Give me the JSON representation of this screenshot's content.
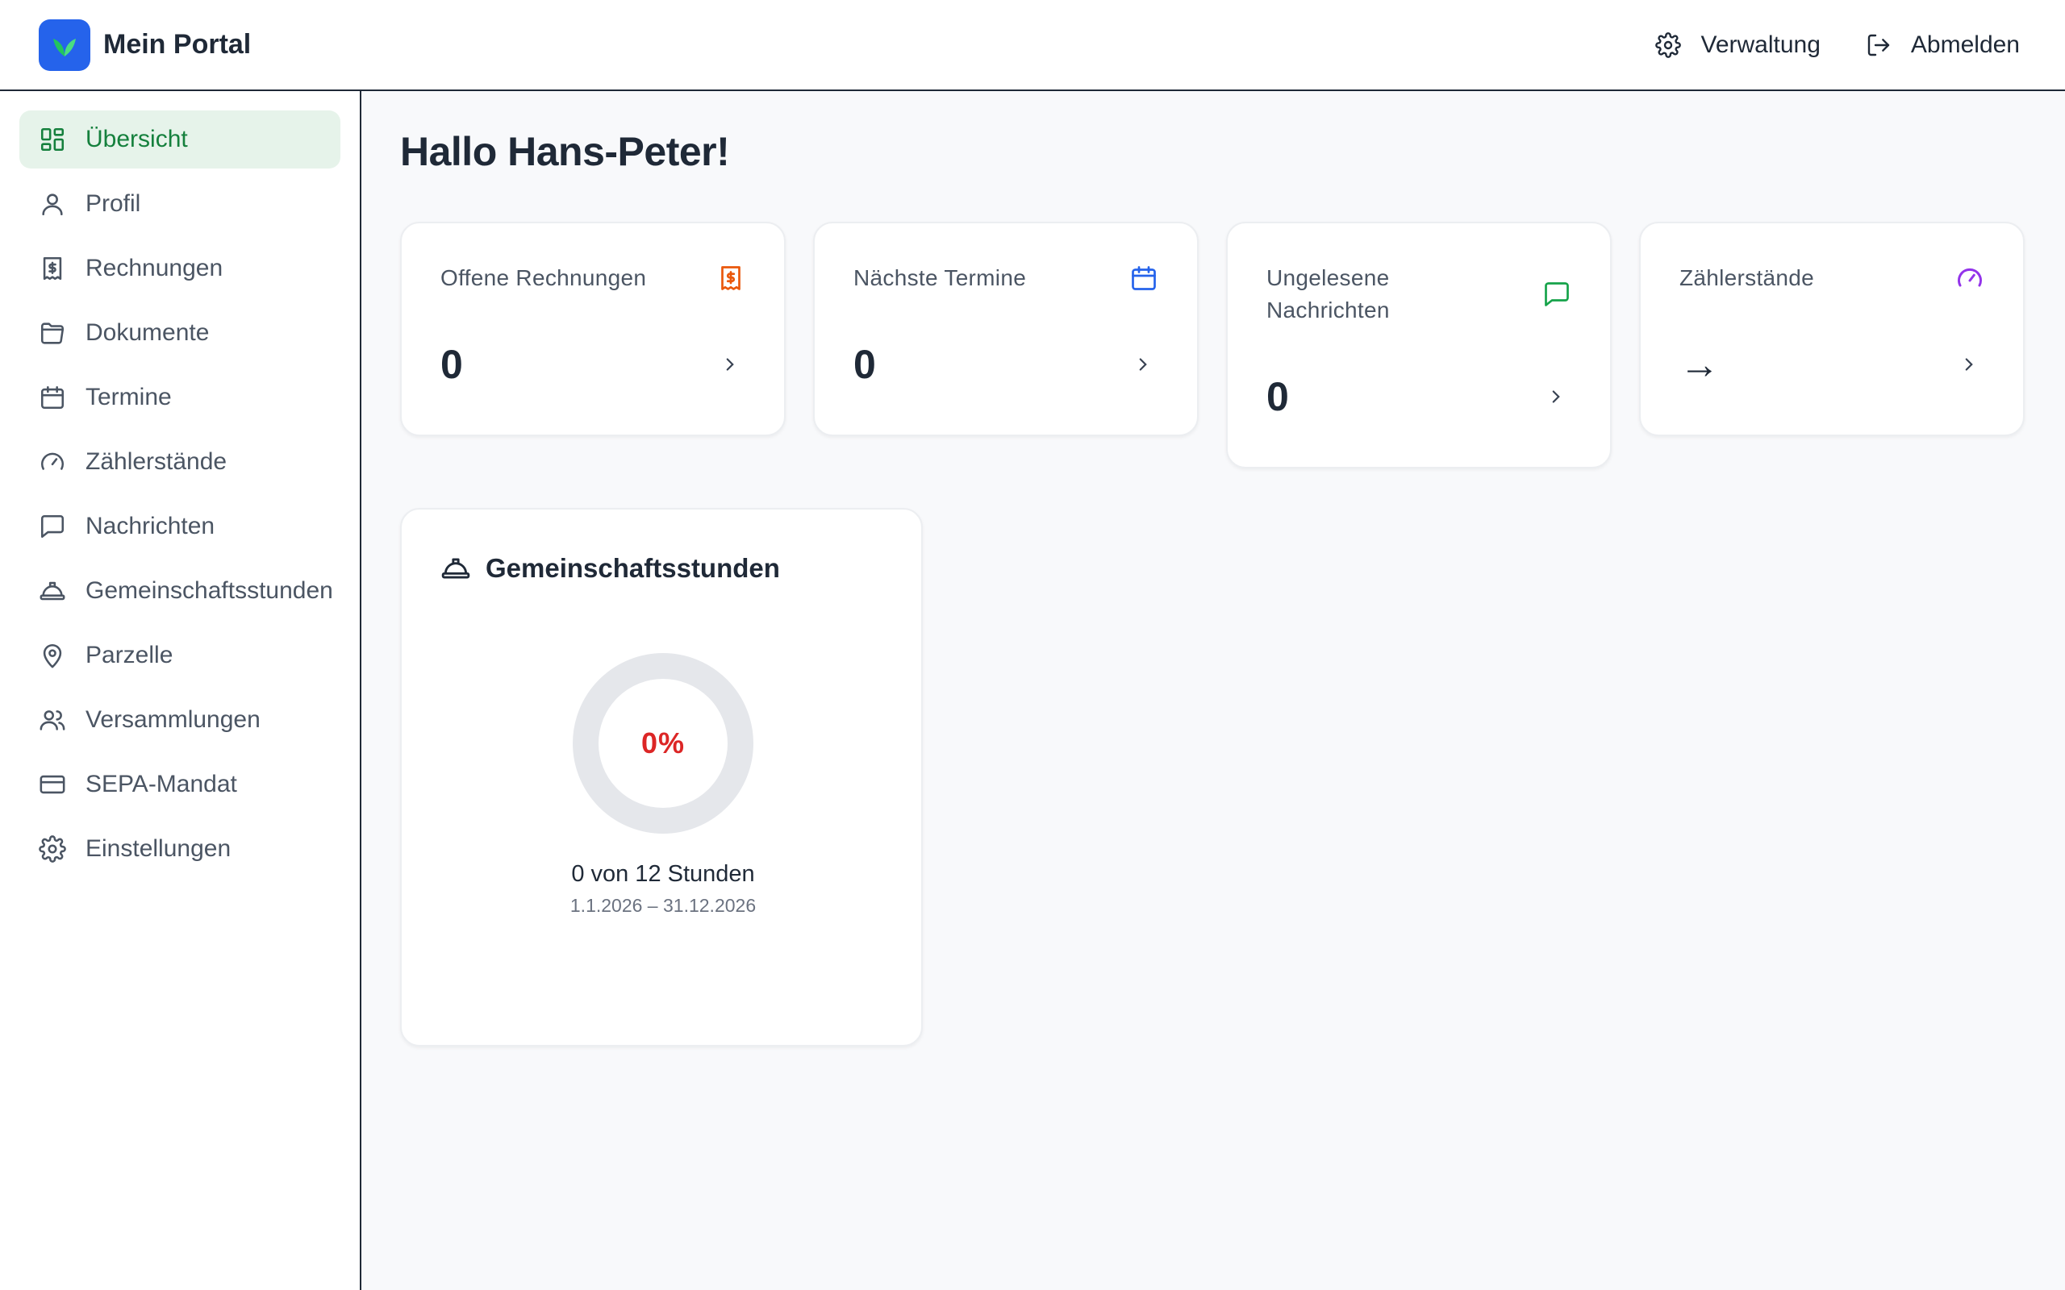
{
  "app": {
    "title": "Mein Portal"
  },
  "header": {
    "admin_label": "Verwaltung",
    "logout_label": "Abmelden"
  },
  "sidebar": {
    "items": [
      {
        "label": "Übersicht",
        "icon": "dashboard-icon",
        "active": true
      },
      {
        "label": "Profil",
        "icon": "user-icon"
      },
      {
        "label": "Rechnungen",
        "icon": "invoice-icon"
      },
      {
        "label": "Dokumente",
        "icon": "folder-icon"
      },
      {
        "label": "Termine",
        "icon": "calendar-icon"
      },
      {
        "label": "Zählerstände",
        "icon": "gauge-icon"
      },
      {
        "label": "Nachrichten",
        "icon": "message-icon"
      },
      {
        "label": "Gemeinschaftsstunden",
        "icon": "hardhat-icon"
      },
      {
        "label": "Parzelle",
        "icon": "map-pin-icon"
      },
      {
        "label": "Versammlungen",
        "icon": "users-icon"
      },
      {
        "label": "SEPA-Mandat",
        "icon": "credit-card-icon"
      },
      {
        "label": "Einstellungen",
        "icon": "gear-icon"
      }
    ]
  },
  "main": {
    "greeting": "Hallo Hans-Peter!",
    "stats": [
      {
        "label": "Offene Rechnungen",
        "value": "0",
        "icon": "invoice-icon",
        "color": "#ea580c"
      },
      {
        "label": "Nächste Termine",
        "value": "0",
        "icon": "calendar-icon",
        "color": "#2563eb"
      },
      {
        "label": "Ungelesene Nachrichten",
        "value": "0",
        "icon": "message-icon",
        "color": "#16a34a"
      },
      {
        "label": "Zählerstände",
        "value": "→",
        "icon": "gauge-icon",
        "color": "#9333ea"
      }
    ],
    "community_hours": {
      "title": "Gemeinschaftsstunden",
      "percent_label": "0%",
      "progress": 0,
      "summary": "0 von 12 Stunden",
      "period": "1.1.2026 – 31.12.2026"
    }
  },
  "colors": {
    "accent_green": "#15803d",
    "active_bg": "#e6f3ea",
    "brand_blue": "#2563eb",
    "danger_red": "#dc2626"
  }
}
